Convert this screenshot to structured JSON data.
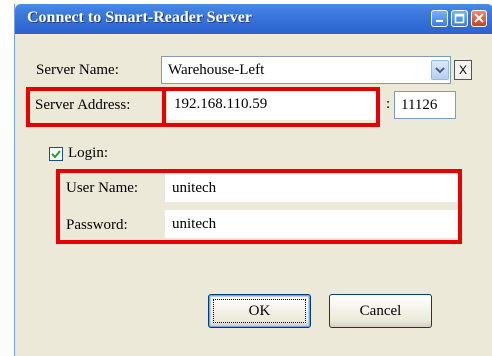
{
  "window": {
    "title": "Connect to Smart-Reader Server"
  },
  "form": {
    "server_name_label": "Server Name:",
    "server_name_value": "Warehouse-Left",
    "clear_button_label": "X",
    "server_address_label": "Server Address:",
    "server_address_value": "192.168.110.59",
    "port_separator": ":",
    "port_value": "11126",
    "login_label": "Login:",
    "login_checked": true,
    "username_label": "User Name:",
    "username_value": "unitech",
    "password_label": "Password:",
    "password_value": "unitech"
  },
  "buttons": {
    "ok_label": "OK",
    "cancel_label": "Cancel"
  },
  "colors": {
    "highlight": "#e60000",
    "titlebar": "#2b63cc"
  }
}
